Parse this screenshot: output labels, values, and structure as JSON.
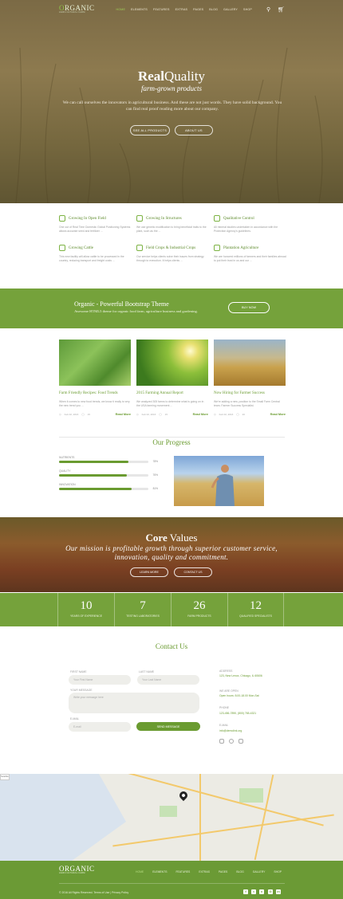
{
  "nav": {
    "logo_prefix": "O",
    "logo_rest": "RGANIC",
    "logo_sub": "AGRICULTURAL FARM",
    "items": [
      "HOME",
      "ELEMENTS",
      "FEATURES",
      "EXTRAS",
      "PAGES",
      "BLOG",
      "GALLERY",
      "SHOP"
    ],
    "active_index": 0
  },
  "hero": {
    "title_bold": "Real",
    "title_rest": "Quality",
    "subtitle": "farm-grown products",
    "text": "We can call ourselves the innovators in agricultural business. And these are not just words. They have solid background. You can find real proof reading more about our company.",
    "btn1": "SEE ALL PRODUCTS",
    "btn2": "ABOUT US"
  },
  "features": [
    {
      "icon": "leaf-icon",
      "title": "Growing In Open Field",
      "desc": "One out of Real Time Domestic Global Positioning Systems allows accurate seed and fertilizer ..."
    },
    {
      "icon": "grid-icon",
      "title": "Growing In Structures",
      "desc": "We use genetic modification to bring beneficial traits to the plant, such as the ..."
    },
    {
      "icon": "check-icon",
      "title": "Qualitative Control",
      "desc": "All mineral studies undertaken in accordance with the Protection Agency's guidelines."
    },
    {
      "icon": "cow-icon",
      "title": "Growing Cattle",
      "desc": "This new facility will allow cattle to be processed in the country, reducing transport and freight costs ..."
    },
    {
      "icon": "crops-icon",
      "title": "Field Crops & Industrial Crops",
      "desc": "Our service helps clients solve their issues from strategy through to execution. It helps clients ..."
    },
    {
      "icon": "irrigation-icon",
      "title": "Plantation Agriculture",
      "desc": "We are honored millions of farmers and their families abroad to put their trust in us and our ..."
    }
  ],
  "banner": {
    "title": "Organic - Powerful Bootstrap Theme",
    "subtitle": "Awesome HTML5 theme for organic food farm, agriculture business and gardening.",
    "button": "BUY NOW"
  },
  "posts": [
    {
      "title": "Farm Friendly Recipes: Food Trends",
      "desc": "When it comes to new food trends, we know it really is very the new trend you ...",
      "date": "Feb 02, 2016",
      "comments": "15",
      "more": "Read More"
    },
    {
      "title": "2015 Farming Annual Report",
      "desc": "We analyzed 305 farms to determine what is going on in the USA farming movement ...",
      "date": "Feb 02, 2016",
      "comments": "15",
      "more": "Read More"
    },
    {
      "title": "Now Hiring for Farmer Success",
      "desc": "We're adding a new, position to the Small Farm Central team. Farmer Success Specialist.",
      "date": "Feb 02, 2016",
      "comments": "20",
      "more": "Read More"
    }
  ],
  "progress": {
    "heading": "Our Progress",
    "bars": [
      {
        "label": "NUTRIENTS",
        "value": 78,
        "pct": "78%"
      },
      {
        "label": "QUALITY",
        "value": 76,
        "pct": "76%"
      },
      {
        "label": "INNOVATION",
        "value": 81,
        "pct": "81%"
      }
    ]
  },
  "core": {
    "title_bold": "Core",
    "title_rest": " Values",
    "mission": "Our mission is profitable growth through superior customer service, innovation, quality and commitment.",
    "btn1": "LEARN MORE",
    "btn2": "CONTACT US"
  },
  "stats": [
    {
      "n": "10",
      "label": "YEARS OF EXPERIENCE"
    },
    {
      "n": "7",
      "label": "TESTING LABORATORIES"
    },
    {
      "n": "26",
      "label": "FARM PRODUCTS"
    },
    {
      "n": "12",
      "label": "QUALIFIED SPECIALISTS"
    }
  ],
  "contact": {
    "heading": "Contact Us",
    "first_label": "FIRST NAME",
    "first_ph": "Your First Name",
    "last_label": "LAST NAME",
    "last_ph": "Your Last Name",
    "msg_label": "YOUR MESSAGE",
    "msg_ph": "Write your message here",
    "email_label": "E-MAIL",
    "email_ph": "E-mail",
    "send": "SEND MESSAGE",
    "address_k": "ADDRESS",
    "address_v": "123, New Lenox, Chicago, IL 60606",
    "open_k": "WE ARE OPEN",
    "open_v": "Open hours: 8.00-18.00 Mon-Sat",
    "phone_k": "PHONE",
    "phone_v": "123-456-7890, (800) 765-4321",
    "email_k": "E-MAIL",
    "email_v": "info@demolink.org"
  },
  "map_tab": "Satellite",
  "footer": {
    "items": [
      "HOME",
      "ELEMENTS",
      "FEATURES",
      "EXTRAS",
      "PAGES",
      "BLOG",
      "GALLERY",
      "SHOP"
    ],
    "copyright": "© 2016 All Rights Reserved. Terms of Use | Privacy Policy",
    "social": [
      "f",
      "t",
      "v",
      "G",
      "in"
    ]
  },
  "colors": {
    "accent": "#6a9b30",
    "banner": "#75a23b",
    "footer": "#6b9a35"
  }
}
